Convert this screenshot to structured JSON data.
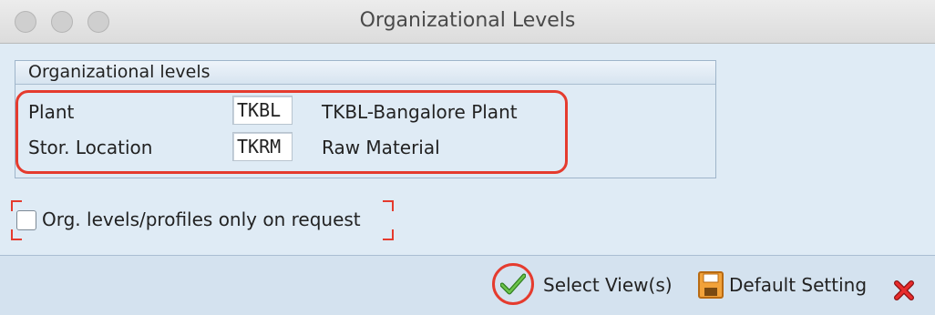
{
  "window": {
    "title": "Organizational Levels"
  },
  "group": {
    "header": "Organizational levels",
    "rows": [
      {
        "label": "Plant",
        "value": "TKBL",
        "description": "TKBL-Bangalore Plant"
      },
      {
        "label": "Stor. Location",
        "value": "TKRM",
        "description": "Raw Material"
      }
    ]
  },
  "option": {
    "label": "Org. levels/profiles only on request",
    "checked": false
  },
  "footer": {
    "select_label": "Select View(s)",
    "default_label": "Default Setting"
  },
  "icons": {
    "select": "green-checkmark-icon",
    "default": "save-disk-icon",
    "cancel": "red-x-icon"
  },
  "colors": {
    "accent": "#e53b2e",
    "background": "#dfebf5",
    "check": "#3a9a2a"
  }
}
